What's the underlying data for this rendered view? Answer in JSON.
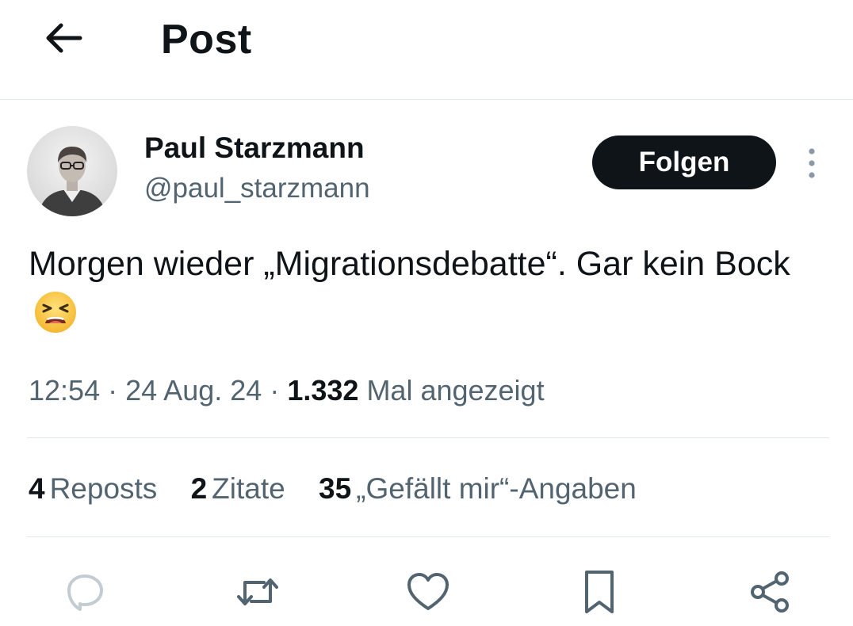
{
  "header": {
    "title": "Post",
    "back_icon": "arrow-left-icon"
  },
  "author": {
    "name": "Paul Starzmann",
    "handle": "@paul_starzmann",
    "avatar_icon": "user-photo"
  },
  "follow_button": {
    "label": "Folgen"
  },
  "more_icon": "more-vertical-icon",
  "tweet": {
    "text": "Morgen wieder „Migrationsdebatte“. Gar kein Bock",
    "emoji": "tired-face-emoji"
  },
  "meta": {
    "time": "12:54",
    "separator": "·",
    "date": "24 Aug. 24",
    "views_count": "1.332",
    "views_label": "Mal angezeigt"
  },
  "stats": [
    {
      "count": "4",
      "label": "Reposts"
    },
    {
      "count": "2",
      "label": "Zitate"
    },
    {
      "count": "35",
      "label": "„Gefällt mir“-Angaben"
    }
  ],
  "actions": {
    "reply_icon": "reply-icon",
    "repost_icon": "repost-icon",
    "like_icon": "heart-icon",
    "bookmark_icon": "bookmark-icon",
    "share_icon": "share-icon"
  },
  "colors": {
    "text_primary": "#0f1419",
    "text_secondary": "#536471",
    "divider": "#e1e6ea",
    "button_bg": "#0f1419",
    "reply_icon": "#c3ccd2",
    "action_icon": "#536471"
  }
}
